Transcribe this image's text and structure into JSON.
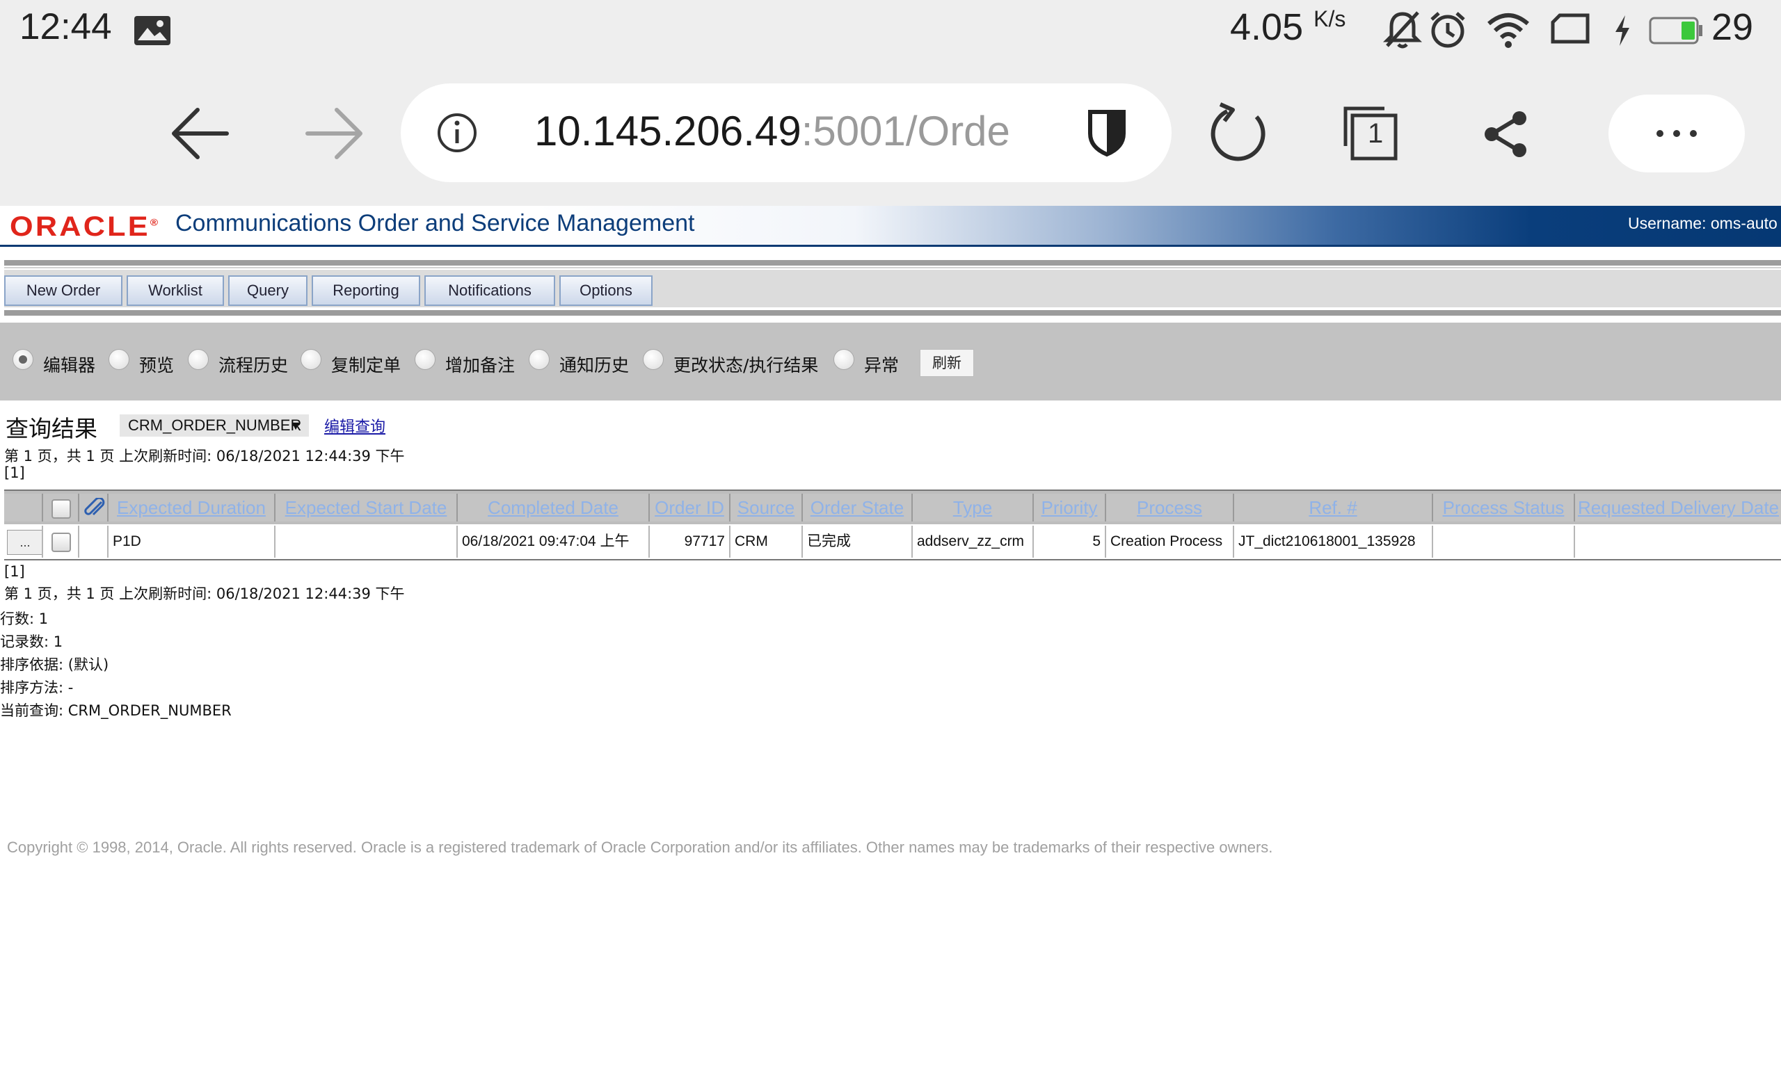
{
  "status_bar": {
    "time": "12:44",
    "net_speed": "4.05",
    "net_speed_unit": "K/s",
    "battery_level": "29",
    "icons": [
      "gallery-icon",
      "mute-icon",
      "alarm-icon",
      "wifi-icon",
      "screen-icon",
      "charging-icon",
      "battery-icon"
    ],
    "battery_color": "#3cc83c"
  },
  "browser": {
    "url_host": "10.145.206.49",
    "url_path": ":5001/Orde",
    "tab_count": "1",
    "icons": [
      "back-arrow-icon",
      "forward-arrow-icon",
      "info-icon",
      "shield-icon",
      "reload-icon",
      "tabs-icon",
      "share-icon",
      "more-icon"
    ]
  },
  "header": {
    "logo": "ORACLE",
    "title": "Communications Order and Service Management",
    "username": "Username:  oms-auto",
    "brand_color": "#e0251b",
    "title_color": "#0c3d7a"
  },
  "tabs": [
    "New Order",
    "Worklist",
    "Query",
    "Reporting",
    "Notifications",
    "Options"
  ],
  "options": {
    "radios": [
      {
        "label": "编辑器",
        "selected": true
      },
      {
        "label": "预览",
        "selected": false
      },
      {
        "label": "流程历史",
        "selected": false
      },
      {
        "label": "复制定单",
        "selected": false
      },
      {
        "label": "增加备注",
        "selected": false
      },
      {
        "label": "通知历史",
        "selected": false
      },
      {
        "label": "更改状态/执行结果",
        "selected": false
      },
      {
        "label": "异常",
        "selected": false
      }
    ],
    "refresh_label": "刷新"
  },
  "query": {
    "title": "查询结果",
    "selected_query": "CRM_ORDER_NUMBER",
    "edit_link": "编辑查询",
    "page_info_top": "第 1 页，共 1 页  上次刷新时间: 06/18/2021 12:44:39 下午",
    "pager_top": "[1]",
    "pager_bottom": "[1]",
    "page_info_bottom": "第 1 页，共 1 页  上次刷新时间: 06/18/2021 12:44:39 下午"
  },
  "table": {
    "columns": [
      "Expected Duration",
      "Expected Start Date",
      "Completed Date",
      "Order ID",
      "Source",
      "Order State",
      "Type",
      "Priority",
      "Process",
      "Ref. #",
      "Process Status",
      "Requested Delivery Date"
    ],
    "rows": [
      {
        "expand": "...",
        "expected_duration": "P1D",
        "expected_start_date": "",
        "completed_date": "06/18/2021 09:47:04 上午",
        "order_id": "97717",
        "source": "CRM",
        "order_state": "已完成",
        "type": "addserv_zz_crm",
        "priority": "5",
        "process": "Creation Process",
        "ref": "JT_dict210618001_135928",
        "process_status": "",
        "requested_delivery_date": ""
      }
    ]
  },
  "summary": {
    "rows": "行数: 1",
    "records": "记录数: 1",
    "sort_by": "排序依据: (默认)",
    "sort_method": "排序方法: -",
    "current_query": "当前查询: CRM_ORDER_NUMBER"
  },
  "footer": {
    "copyright": "Copyright © 1998, 2014, Oracle. All rights reserved. Oracle is a registered trademark of Oracle Corporation and/or its affiliates. Other names may be trademarks of their respective owners."
  }
}
